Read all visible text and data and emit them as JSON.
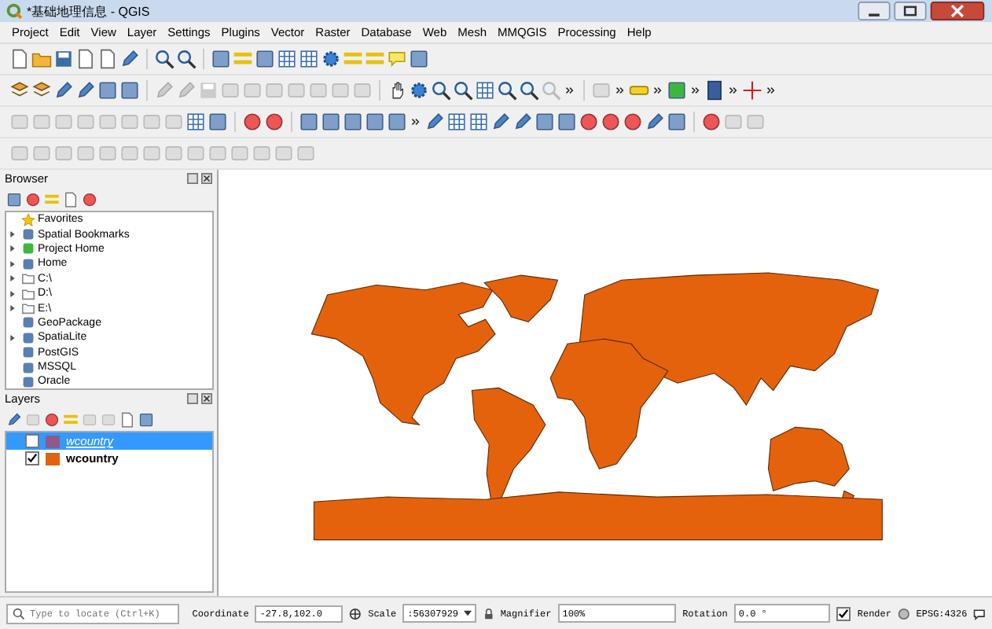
{
  "window": {
    "title": "*基础地理信息 - QGIS"
  },
  "menu": [
    "Project",
    "Edit",
    "View",
    "Layer",
    "Settings",
    "Plugins",
    "Vector",
    "Raster",
    "Database",
    "Web",
    "Mesh",
    "MMQGIS",
    "Processing",
    "Help"
  ],
  "browser": {
    "title": "Browser",
    "items": [
      {
        "label": "Favorites",
        "expandable": false
      },
      {
        "label": "Spatial Bookmarks",
        "expandable": true
      },
      {
        "label": "Project Home",
        "expandable": true
      },
      {
        "label": "Home",
        "expandable": true
      },
      {
        "label": "C:\\",
        "expandable": true
      },
      {
        "label": "D:\\",
        "expandable": true
      },
      {
        "label": "E:\\",
        "expandable": true
      },
      {
        "label": "GeoPackage",
        "expandable": false
      },
      {
        "label": "SpatiaLite",
        "expandable": true
      },
      {
        "label": "PostGIS",
        "expandable": false
      },
      {
        "label": "MSSQL",
        "expandable": false
      },
      {
        "label": "Oracle",
        "expandable": false
      }
    ]
  },
  "layers": {
    "title": "Layers",
    "items": [
      {
        "name": "wcountry",
        "visible": false,
        "selected": true,
        "color": "#8e5a8c"
      },
      {
        "name": "wcountry",
        "visible": true,
        "selected": false,
        "color": "#e4620c"
      }
    ]
  },
  "status_bar": {
    "locate_placeholder": "Type to locate (Ctrl+K)",
    "coordinate_label": "Coordinate",
    "coordinate": "-27.8,102.0",
    "scale_label": "Scale",
    "scale": ":56307929",
    "magnifier_label": "Magnifier",
    "magnifier": "100%",
    "rotation_label": "Rotation",
    "rotation": "0.0 °",
    "render_label": "Render",
    "render": true,
    "crs": "EPSG:4326"
  }
}
